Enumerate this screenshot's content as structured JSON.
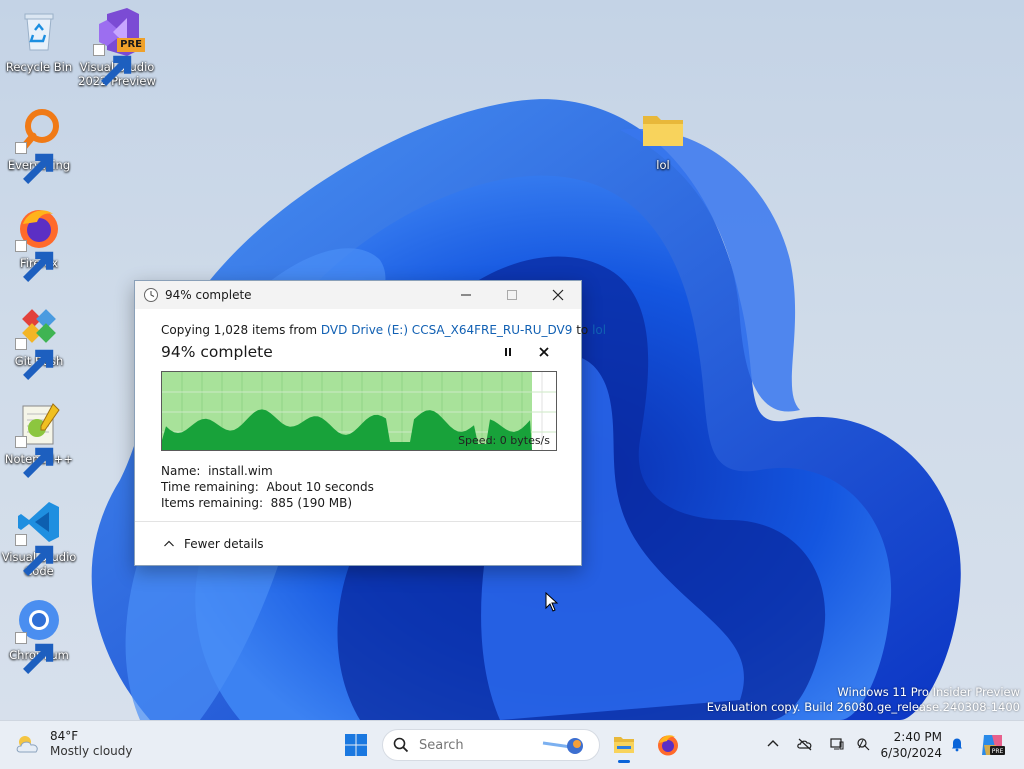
{
  "desktop": {
    "icons": [
      {
        "label": "Recycle Bin",
        "icon": "recycle-bin-icon"
      },
      {
        "label": "Visual Studio 2022 Preview",
        "line1": "Visual Studio",
        "line2": "2022 Preview",
        "icon": "visual-studio-icon",
        "badge": "PRE"
      },
      {
        "label": "Everything",
        "icon": "everything-search-icon"
      },
      {
        "label": "Firefox",
        "icon": "firefox-icon"
      },
      {
        "label": "Git Bash",
        "icon": "git-bash-icon"
      },
      {
        "label": "Notepad++",
        "icon": "notepad-plus-plus-icon"
      },
      {
        "label": "Visual Studio Code",
        "line1": "Visual Studio",
        "line2": "Code",
        "icon": "vscode-icon"
      },
      {
        "label": "Chromium",
        "icon": "chromium-icon"
      },
      {
        "label": "lol",
        "icon": "folder-icon"
      }
    ],
    "watermark": {
      "line1": "Windows 11 Pro Insider Preview",
      "line2": "Evaluation copy. Build 26080.ge_release.240308-1400"
    }
  },
  "dialog": {
    "title": "94% complete",
    "copy_prefix": "Copying 1,028 items from ",
    "source": "DVD Drive (E:) CCSA_X64FRE_RU-RU_DV9",
    "copy_to": " to ",
    "destination": "lol",
    "progress_text": "94% complete",
    "progress": 0.94,
    "speed": "Speed: 0 bytes/s",
    "name_label": "Name:",
    "name_value": "install.wim",
    "time_label": "Time remaining:",
    "time_value": "About 10 seconds",
    "items_label": "Items remaining:",
    "items_value": "885 (190 MB)",
    "fewer_details": "Fewer details",
    "colors": {
      "graph_fill": "#18a23a",
      "graph_bg": "#a8e29a",
      "link": "#1160b3"
    }
  },
  "taskbar": {
    "weather_temp": "84°F",
    "weather_desc": "Mostly cloudy",
    "search_placeholder": "Search",
    "time": "2:40 PM",
    "date": "6/30/2024",
    "accent": "#0a64d8"
  }
}
